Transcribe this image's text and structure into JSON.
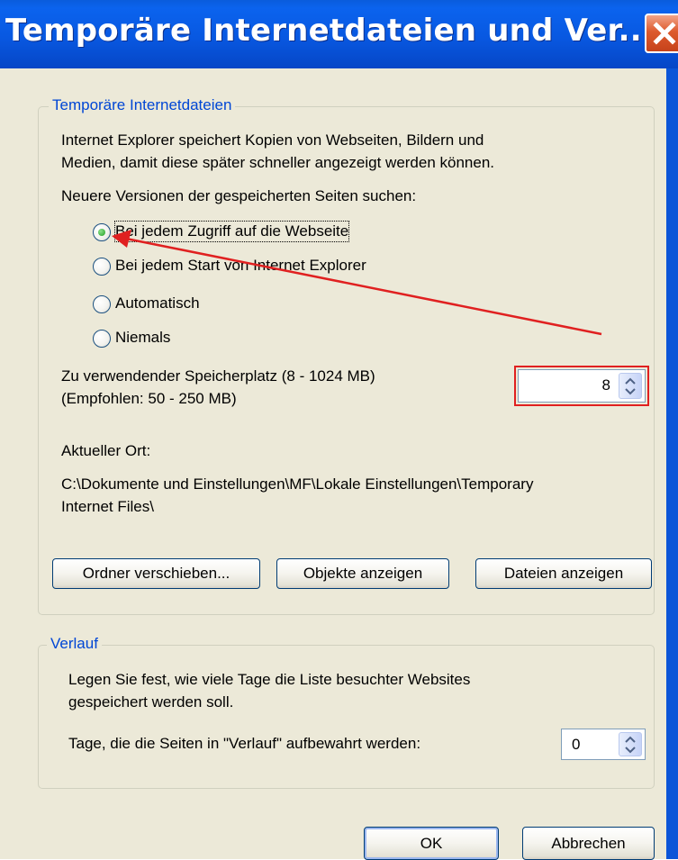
{
  "window": {
    "title": "Temporäre Internetdateien und Ver..."
  },
  "temp_files": {
    "legend": "Temporäre Internetdateien",
    "description_line1": "Internet Explorer speichert Kopien von Webseiten, Bildern und",
    "description_line2": "Medien, damit diese später schneller angezeigt werden können.",
    "check_label": "Neuere Versionen der gespeicherten Seiten suchen:",
    "options": [
      {
        "label": "Bei jedem Zugriff auf die Webseite",
        "selected": true
      },
      {
        "label": "Bei jedem Start von Internet Explorer",
        "selected": false
      },
      {
        "label": "Automatisch",
        "selected": false
      },
      {
        "label": "Niemals",
        "selected": false
      }
    ],
    "space_label_line1": "Zu verwendender Speicherplatz (8 - 1024 MB)",
    "space_label_line2": "(Empfohlen: 50 - 250 MB)",
    "space_value": "8",
    "location_label": "Aktueller Ort:",
    "location_line1": "C:\\Dokumente und Einstellungen\\MF\\Lokale Einstellungen\\Temporary",
    "location_line2": "Internet Files\\",
    "buttons": {
      "move_folder": "Ordner verschieben...",
      "view_objects": "Objekte anzeigen",
      "view_files": "Dateien anzeigen"
    }
  },
  "history": {
    "legend": "Verlauf",
    "description_line1": "Legen Sie fest, wie viele Tage die Liste besuchter Websites",
    "description_line2": "gespeichert werden soll.",
    "days_label": "Tage, die die Seiten in \"Verlauf\" aufbewahrt werden:",
    "days_value": "0"
  },
  "footer": {
    "ok": "OK",
    "cancel": "Abbrechen"
  },
  "colors": {
    "titlebar": "#0858e1",
    "legend_text": "#0046d5",
    "annotation": "#e02020"
  }
}
